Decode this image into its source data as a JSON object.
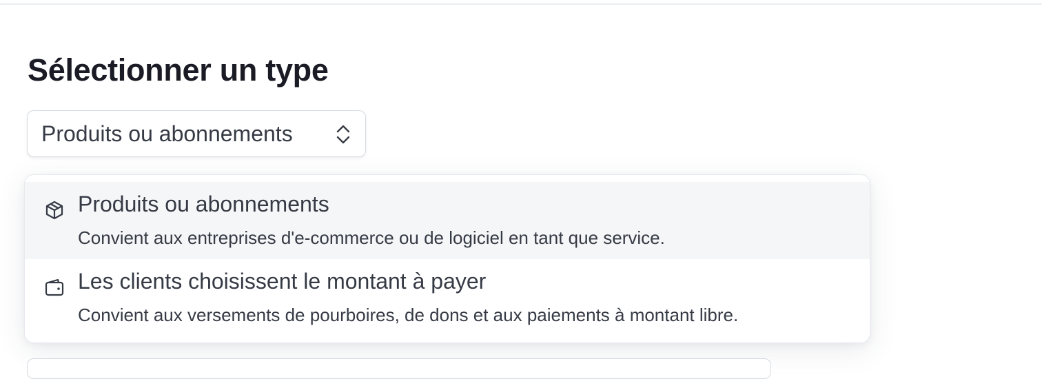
{
  "page": {
    "title": "Sélectionner un type"
  },
  "type_select": {
    "value": "Produits ou abonnements",
    "icon": "chevron-up-down-icon"
  },
  "dropdown": {
    "options": [
      {
        "title": "Produits ou abonnements",
        "description": "Convient aux entreprises d'e-commerce ou de logiciel en tant que service.",
        "icon": "package-box-icon",
        "highlighted": true
      },
      {
        "title": "Les clients choisissent le montant à payer",
        "description": "Convient aux versements de pourboires, de dons et aux paiements à montant libre.",
        "icon": "wallet-icon",
        "highlighted": false
      }
    ]
  },
  "colors": {
    "text_primary": "#1a1b25",
    "text_secondary": "#353a44",
    "border": "#d5dbe1",
    "highlight_bg": "#f5f6f8"
  }
}
